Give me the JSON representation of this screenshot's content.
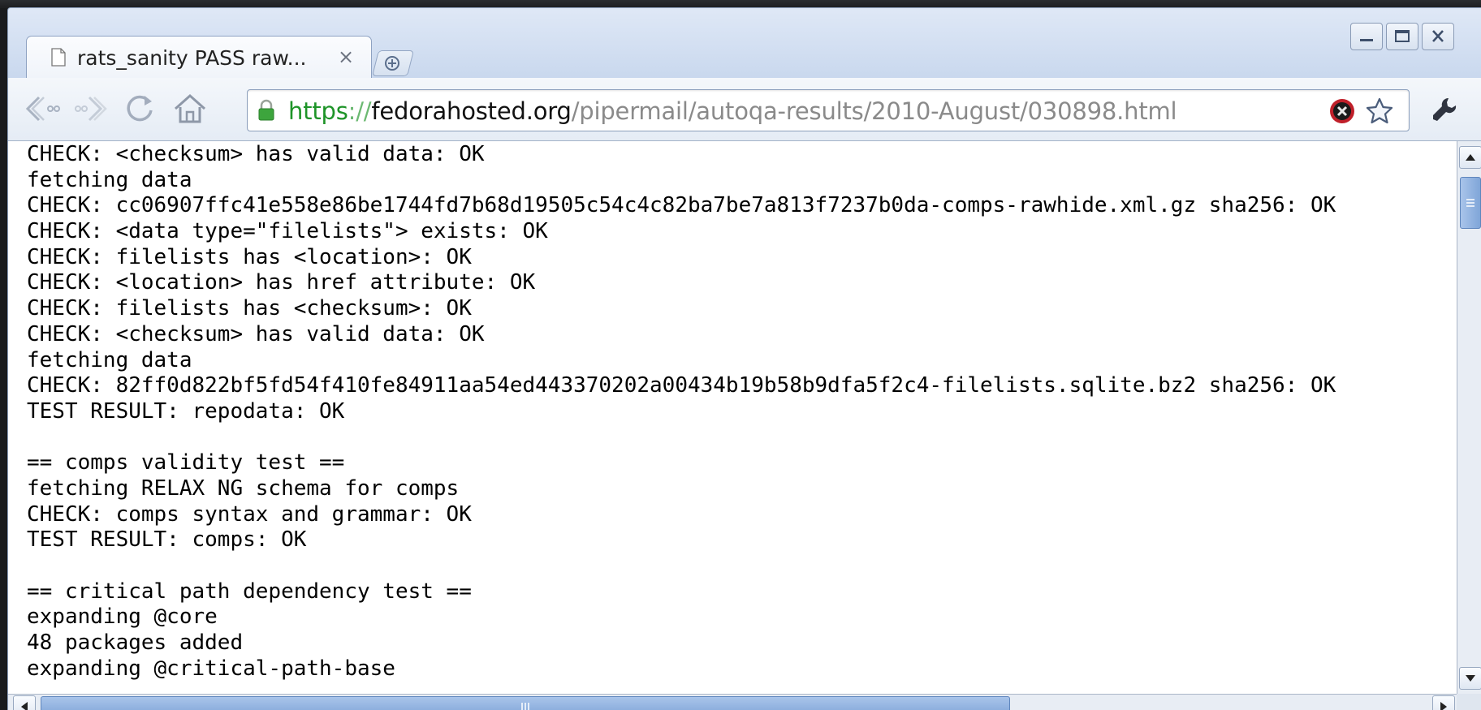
{
  "tab": {
    "title": "rats_sanity PASS raw...",
    "close_glyph": "×"
  },
  "omnibox": {
    "scheme": "https",
    "separator": "://",
    "host": "fedorahosted.org",
    "path": "/pipermail/autoqa-results/2010-August/030898.html"
  },
  "window_controls": {
    "minimize": "minimize-icon",
    "maximize": "maximize-icon",
    "close": "close-icon"
  },
  "content_lines": [
    "CHECK: <checksum> has valid data: OK",
    "fetching data",
    "CHECK: cc06907ffc41e558e86be1744fd7b68d19505c54c4c82ba7be7a813f7237b0da-comps-rawhide.xml.gz sha256: OK",
    "CHECK: <data type=\"filelists\"> exists: OK",
    "CHECK: filelists has <location>: OK",
    "CHECK: <location> has href attribute: OK",
    "CHECK: filelists has <checksum>: OK",
    "CHECK: <checksum> has valid data: OK",
    "fetching data",
    "CHECK: 82ff0d822bf5fd54f410fe84911aa54ed443370202a00434b19b58b9dfa5f2c4-filelists.sqlite.bz2 sha256: OK",
    "TEST RESULT: repodata: OK",
    "",
    "== comps validity test ==",
    "fetching RELAX NG schema for comps",
    "CHECK: comps syntax and grammar: OK",
    "TEST RESULT: comps: OK",
    "",
    "== critical path dependency test ==",
    "expanding @core",
    "48 packages added",
    "expanding @critical-path-base"
  ],
  "colors": {
    "secure_scheme": "#1e9428",
    "host_text": "#111111",
    "path_text": "#8a8a8a",
    "chrome_blue": "#c5d5ec",
    "scroll_thumb": "#7fa5d8"
  }
}
